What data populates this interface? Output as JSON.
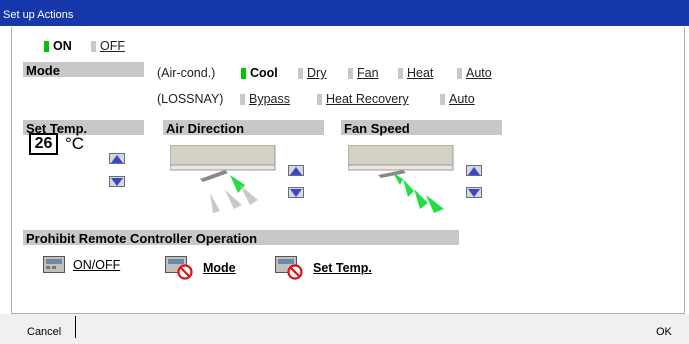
{
  "window": {
    "title": "Set up Actions"
  },
  "power": {
    "options": [
      {
        "label": "ON",
        "selected": true
      },
      {
        "label": "OFF",
        "selected": false
      }
    ]
  },
  "mode": {
    "header": "Mode",
    "aircond_label": "(Air-cond.)",
    "aircond_options": [
      {
        "label": "Cool",
        "selected": true
      },
      {
        "label": "Dry",
        "selected": false
      },
      {
        "label": "Fan",
        "selected": false
      },
      {
        "label": "Heat",
        "selected": false
      },
      {
        "label": "Auto",
        "selected": false
      }
    ],
    "lossnay_label": "(LOSSNAY)",
    "lossnay_options": [
      {
        "label": "Bypass",
        "selected": false
      },
      {
        "label": "Heat Recovery",
        "selected": false
      },
      {
        "label": "Auto",
        "selected": false
      }
    ]
  },
  "set_temp": {
    "header": "Set Temp.",
    "value": "26",
    "unit": "°C"
  },
  "air_direction": {
    "header": "Air Direction"
  },
  "fan_speed": {
    "header": "Fan Speed"
  },
  "prohibit": {
    "header": "Prohibit Remote Controller Operation",
    "items": [
      {
        "label": "ON/OFF",
        "prohibited": false
      },
      {
        "label": "Mode",
        "prohibited": true
      },
      {
        "label": "Set Temp.",
        "prohibited": true
      }
    ]
  },
  "footer": {
    "cancel_label": "Cancel",
    "ok_label": "OK"
  },
  "colors": {
    "title_bar": "#1637a9",
    "selected_marker": "#00c400",
    "prohibit_sign": "#e01010"
  }
}
